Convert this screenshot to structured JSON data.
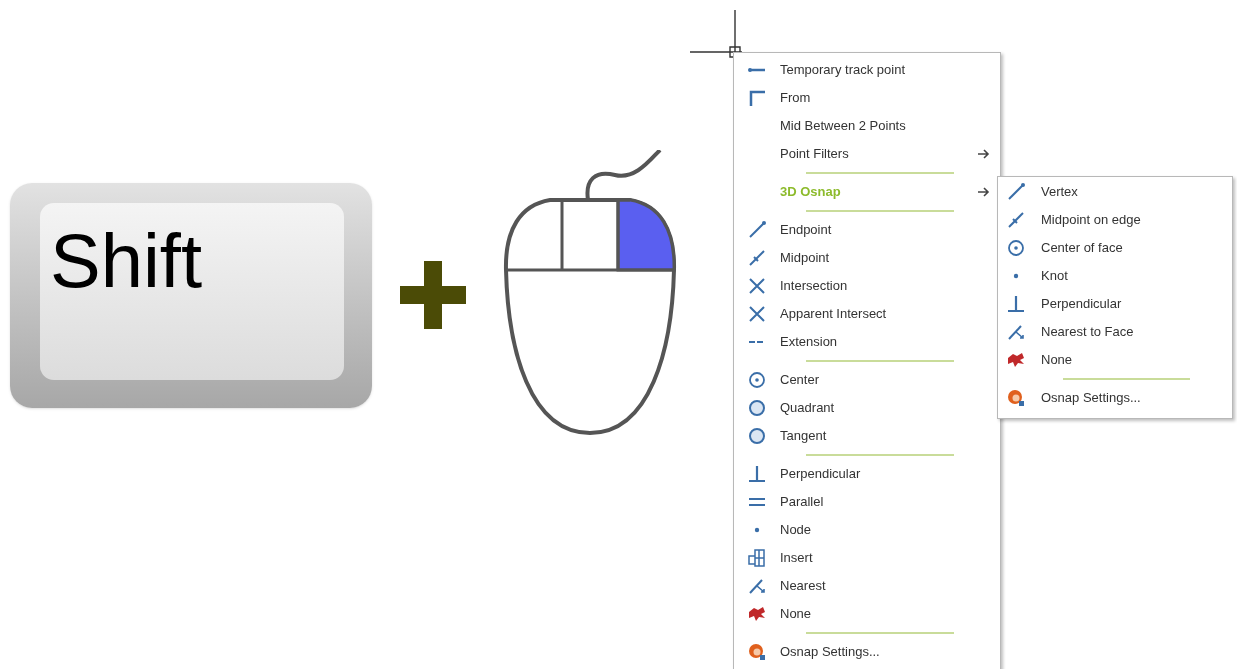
{
  "key": {
    "label": "Shift"
  },
  "main_menu": {
    "items": [
      {
        "kind": "track",
        "label": "Temporary track point",
        "submenu": false,
        "expanded": false
      },
      {
        "kind": "from",
        "label": "From",
        "submenu": false,
        "expanded": false
      },
      {
        "kind": "plain",
        "label": "Mid Between 2 Points",
        "submenu": false,
        "expanded": false
      },
      {
        "kind": "plain",
        "label": "Point Filters",
        "submenu": true,
        "expanded": false
      },
      {
        "kind": "separator"
      },
      {
        "kind": "plain",
        "label": "3D Osnap",
        "submenu": true,
        "expanded": true
      },
      {
        "kind": "separator"
      },
      {
        "kind": "endpoint",
        "label": "Endpoint",
        "submenu": false,
        "expanded": false
      },
      {
        "kind": "midpoint",
        "label": "Midpoint",
        "submenu": false,
        "expanded": false
      },
      {
        "kind": "cross",
        "label": "Intersection",
        "submenu": false,
        "expanded": false
      },
      {
        "kind": "cross",
        "label": "Apparent Intersect",
        "submenu": false,
        "expanded": false
      },
      {
        "kind": "dash",
        "label": "Extension",
        "submenu": false,
        "expanded": false
      },
      {
        "kind": "separator"
      },
      {
        "kind": "center",
        "label": "Center",
        "submenu": false,
        "expanded": false
      },
      {
        "kind": "circle",
        "label": "Quadrant",
        "submenu": false,
        "expanded": false
      },
      {
        "kind": "circle",
        "label": "Tangent",
        "submenu": false,
        "expanded": false
      },
      {
        "kind": "separator"
      },
      {
        "kind": "perpendicular",
        "label": "Perpendicular",
        "submenu": false,
        "expanded": false
      },
      {
        "kind": "parallel",
        "label": "Parallel",
        "submenu": false,
        "expanded": false
      },
      {
        "kind": "dot",
        "label": "Node",
        "submenu": false,
        "expanded": false
      },
      {
        "kind": "insert",
        "label": "Insert",
        "submenu": false,
        "expanded": false
      },
      {
        "kind": "nearest",
        "label": "Nearest",
        "submenu": false,
        "expanded": false
      },
      {
        "kind": "none",
        "label": "None",
        "submenu": false,
        "expanded": false
      },
      {
        "kind": "separator"
      },
      {
        "kind": "settings",
        "label": "Osnap Settings...",
        "submenu": false,
        "expanded": false
      }
    ]
  },
  "submenu": {
    "items": [
      {
        "kind": "endpoint",
        "label": "Vertex"
      },
      {
        "kind": "midpoint",
        "label": "Midpoint on edge"
      },
      {
        "kind": "center",
        "label": "Center of face"
      },
      {
        "kind": "dot",
        "label": "Knot"
      },
      {
        "kind": "perpendicular",
        "label": "Perpendicular"
      },
      {
        "kind": "nearest",
        "label": "Nearest to Face"
      },
      {
        "kind": "none",
        "label": "None"
      },
      {
        "kind": "separator"
      },
      {
        "kind": "settings",
        "label": "Osnap Settings..."
      }
    ]
  }
}
